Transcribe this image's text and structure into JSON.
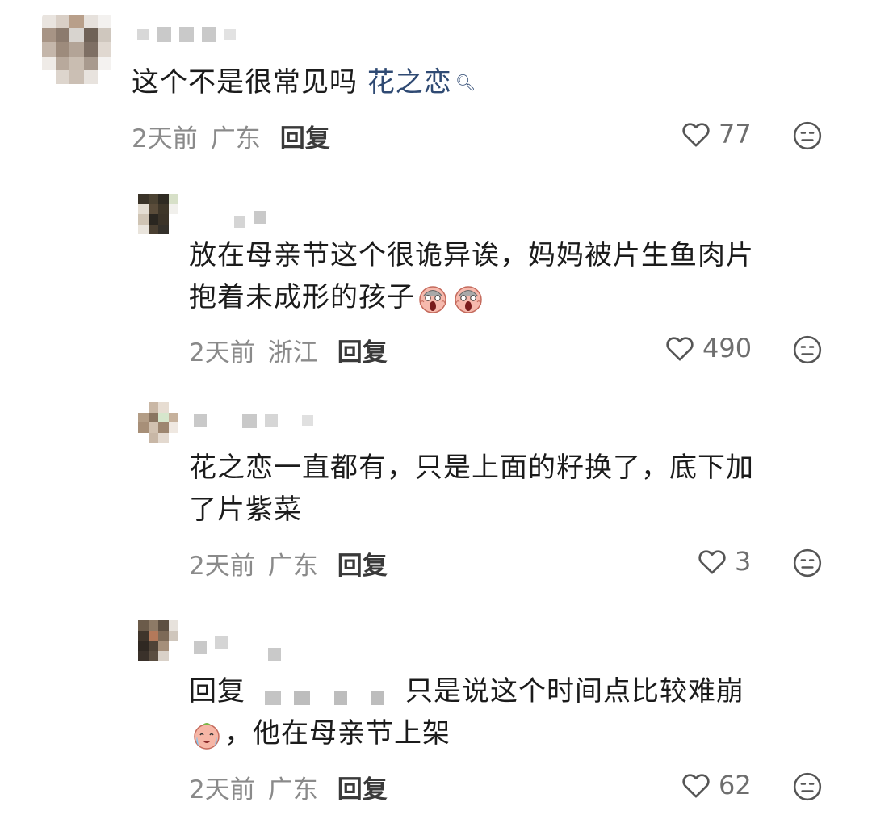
{
  "comments": [
    {
      "text_before_link": "这个不是很常见吗 ",
      "link_text": "花之恋",
      "time": "2天前",
      "region": "广东",
      "reply_label": "回复",
      "likes": "77"
    },
    {
      "text_line1": "放在母亲节这个很诡异诶，妈妈被片生鱼肉片",
      "text_line2": "抱着未成形的孩子",
      "time": "2天前",
      "region": "浙江",
      "reply_label": "回复",
      "likes": "490"
    },
    {
      "text_line1": "花之恋一直都有，只是上面的籽换了，底下加",
      "text_line2": "了片紫菜",
      "time": "2天前",
      "region": "广东",
      "reply_label": "回复",
      "likes": "3"
    },
    {
      "reply_prefix": "回复",
      "text_line1": "只是说这个时间点比较难崩",
      "text_line2": "，他在母亲节上架",
      "time": "2天前",
      "region": "广东",
      "reply_label": "回复",
      "likes": "62"
    }
  ],
  "icons": {
    "like": "heart-outline-icon",
    "dislike": "neutral-face-icon",
    "emoji_scream": "scream-face-emoji",
    "emoji_cry": "crying-face-emoji",
    "search": "search-icon"
  },
  "colors": {
    "link": "#2f4a73",
    "meta": "#8a8a8a",
    "text": "#1b1b1b"
  }
}
